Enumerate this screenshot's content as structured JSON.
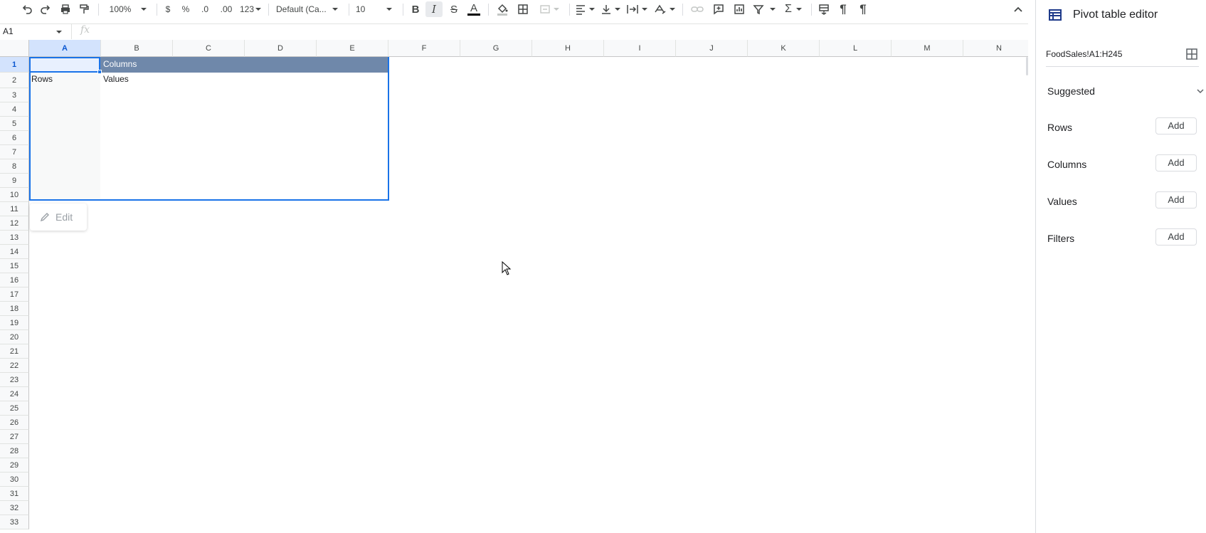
{
  "toolbar": {
    "zoom": "100%",
    "currency": "$",
    "percent": "%",
    "decrease_decimals": ".0",
    "increase_decimals": ".00",
    "number_format": "123",
    "font_family": "Default (Ca...",
    "font_size": "10",
    "icons": [
      "undo-icon",
      "redo-icon",
      "print-icon",
      "paint-format-icon",
      "bold-icon",
      "italic-icon",
      "strikethrough-icon",
      "text-color-icon",
      "fill-color-icon",
      "borders-icon",
      "merge-cells-icon",
      "align-left-icon",
      "vertical-align-icon",
      "text-wrap-icon",
      "text-rotate-icon",
      "link-icon",
      "comment-icon",
      "chart-icon",
      "filter-icon",
      "functions-icon",
      "freeze-icon",
      "ltr-icon",
      "rtl-icon",
      "collapse-icon"
    ]
  },
  "formula_bar": {
    "cell_ref": "A1",
    "fx": "fx"
  },
  "grid": {
    "columns": [
      "A",
      "B",
      "C",
      "D",
      "E",
      "F",
      "G",
      "H",
      "I",
      "J",
      "K",
      "L",
      "M",
      "N"
    ],
    "rows": [
      "1",
      "2",
      "3",
      "4",
      "5",
      "6",
      "7",
      "8",
      "9",
      "10",
      "11",
      "12",
      "13",
      "14",
      "15",
      "16",
      "17",
      "18",
      "19",
      "20",
      "21",
      "22",
      "23",
      "24",
      "25",
      "26",
      "27",
      "28",
      "29",
      "30",
      "31",
      "32",
      "33"
    ],
    "selected_col": "A",
    "selected_row": "1"
  },
  "pivot": {
    "header_label": "Columns",
    "rows_label": "Rows",
    "values_label": "Values",
    "header_color": "#6f88aa",
    "edit_label": "Edit"
  },
  "side_panel": {
    "title": "Pivot table editor",
    "range": "FoodSales!A1:H245",
    "suggested_label": "Suggested",
    "sections": [
      {
        "label": "Rows",
        "add": "Add"
      },
      {
        "label": "Columns",
        "add": "Add"
      },
      {
        "label": "Values",
        "add": "Add"
      },
      {
        "label": "Filters",
        "add": "Add"
      }
    ]
  },
  "colors": {
    "selection": "#1a73e8",
    "header_bg": "#f8f9fa",
    "selected_header_bg": "#d3e3fd"
  }
}
